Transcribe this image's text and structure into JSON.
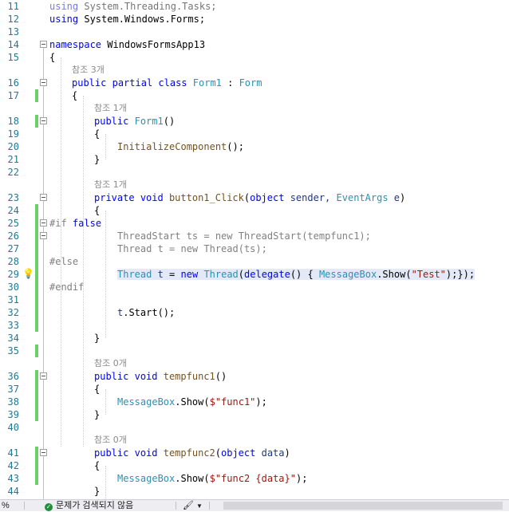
{
  "editor": {
    "lines": [
      {
        "n": "11",
        "tokens": [
          [
            "kw",
            "using"
          ],
          [
            "",
            "System.Threading.Tasks;"
          ]
        ],
        "dim": true
      },
      {
        "n": "12",
        "tokens": [
          [
            "kw",
            "using"
          ],
          [
            "",
            "System.Windows.Forms;"
          ]
        ]
      },
      {
        "n": "13",
        "tokens": []
      },
      {
        "n": "14",
        "tokens": [
          [
            "kw",
            "namespace"
          ],
          [
            "",
            "WindowsFormsApp13"
          ]
        ]
      },
      {
        "n": "15",
        "tokens": [
          [
            "",
            "{"
          ]
        ]
      },
      {
        "n": "16",
        "lens": "참조 3개",
        "tokens": [
          [
            "kw",
            "public"
          ],
          [
            "kw",
            "partial"
          ],
          [
            "kw",
            "class"
          ],
          [
            "ty",
            "Form1"
          ],
          [
            "",
            ":"
          ],
          [
            "ty",
            "Form"
          ]
        ]
      },
      {
        "n": "17",
        "tokens": [
          [
            "",
            "{"
          ]
        ]
      },
      {
        "n": "18",
        "lens": "참조 1개",
        "tokens": [
          [
            "kw",
            "public"
          ],
          [
            "ty",
            "Form1"
          ],
          [
            "",
            "()"
          ]
        ]
      },
      {
        "n": "19",
        "tokens": [
          [
            "",
            "{"
          ]
        ]
      },
      {
        "n": "20",
        "tokens": [
          [
            "fn",
            "InitializeComponent"
          ],
          [
            "",
            "();"
          ]
        ]
      },
      {
        "n": "21",
        "tokens": [
          [
            "",
            "}"
          ]
        ]
      },
      {
        "n": "22",
        "tokens": []
      },
      {
        "n": "23",
        "lens": "참조 1개",
        "tokens": [
          [
            "kw",
            "private"
          ],
          [
            "kw",
            "void"
          ],
          [
            "fn",
            "button1_Click"
          ],
          [
            "",
            "("
          ],
          [
            "kw",
            "object"
          ],
          [
            "id",
            "sender,"
          ],
          [
            "ty",
            "EventArgs"
          ],
          [
            "id",
            "e"
          ],
          [
            "",
            ")"
          ]
        ]
      },
      {
        "n": "24",
        "tokens": [
          [
            "",
            "{"
          ]
        ]
      },
      {
        "n": "25",
        "tokens": [
          [
            "pre",
            "#if"
          ],
          [
            "kw",
            "false"
          ]
        ]
      },
      {
        "n": "26",
        "tokens": [
          [
            "pre",
            "ThreadStart ts = new ThreadStart(tempfunc1);"
          ]
        ]
      },
      {
        "n": "27",
        "tokens": [
          [
            "pre",
            "Thread t = new Thread(ts);"
          ]
        ]
      },
      {
        "n": "28",
        "tokens": [
          [
            "pre",
            "#else"
          ]
        ]
      },
      {
        "n": "29",
        "tokens": [
          [
            "ty",
            "Thread"
          ],
          [
            "id",
            "t"
          ],
          [
            "",
            "="
          ],
          [
            "kw",
            "new"
          ],
          [
            "ty",
            "Thread"
          ],
          [
            "",
            "("
          ],
          [
            "kw",
            "delegate"
          ],
          [
            "",
            "() {"
          ],
          [
            "ty",
            "MessageBox"
          ],
          [
            "",
            ".Show("
          ],
          [
            "st",
            "\"Test\""
          ],
          [
            "",
            ");});"
          ]
        ]
      },
      {
        "n": "30",
        "tokens": [
          [
            "pre",
            "#endif"
          ]
        ]
      },
      {
        "n": "31",
        "tokens": []
      },
      {
        "n": "32",
        "tokens": [
          [
            "id",
            "t"
          ],
          [
            "",
            ".Start();"
          ]
        ]
      },
      {
        "n": "33",
        "tokens": []
      },
      {
        "n": "34",
        "tokens": [
          [
            "",
            "}"
          ]
        ]
      },
      {
        "n": "35",
        "tokens": []
      },
      {
        "n": "36",
        "lens": "참조 0개",
        "tokens": [
          [
            "kw",
            "public"
          ],
          [
            "kw",
            "void"
          ],
          [
            "fn",
            "tempfunc1"
          ],
          [
            "",
            "()"
          ]
        ]
      },
      {
        "n": "37",
        "tokens": [
          [
            "",
            "{"
          ]
        ]
      },
      {
        "n": "38",
        "tokens": [
          [
            "ty",
            "MessageBox"
          ],
          [
            "",
            ".Show("
          ],
          [
            "st",
            "$\"func1\""
          ],
          [
            "",
            ");"
          ]
        ]
      },
      {
        "n": "39",
        "tokens": [
          [
            "",
            "}"
          ]
        ]
      },
      {
        "n": "40",
        "tokens": []
      },
      {
        "n": "41",
        "lens": "참조 0개",
        "tokens": [
          [
            "kw",
            "public"
          ],
          [
            "kw",
            "void"
          ],
          [
            "fn",
            "tempfunc2"
          ],
          [
            "",
            "("
          ],
          [
            "kw",
            "object"
          ],
          [
            "id",
            "data"
          ],
          [
            "",
            ")"
          ]
        ]
      },
      {
        "n": "42",
        "tokens": [
          [
            "",
            "{"
          ]
        ]
      },
      {
        "n": "43",
        "tokens": [
          [
            "ty",
            "MessageBox"
          ],
          [
            "",
            ".Show("
          ],
          [
            "st",
            "$\"func2 {data}\""
          ],
          [
            "",
            ");"
          ]
        ]
      },
      {
        "n": "44",
        "tokens": [
          [
            "",
            "}"
          ]
        ]
      }
    ]
  },
  "status": {
    "zoom": "%",
    "issues": "문제가 검색되지 않음",
    "issues_icon": "check-circle-icon",
    "brush_icon": "paintbrush-icon",
    "dropdown_icon": "chevron-down-icon"
  },
  "colors": {
    "keyword": "#0000ff",
    "type": "#2b91af",
    "string": "#a31515",
    "line_number": "#237893",
    "change_bar": "#6ccf6a"
  }
}
